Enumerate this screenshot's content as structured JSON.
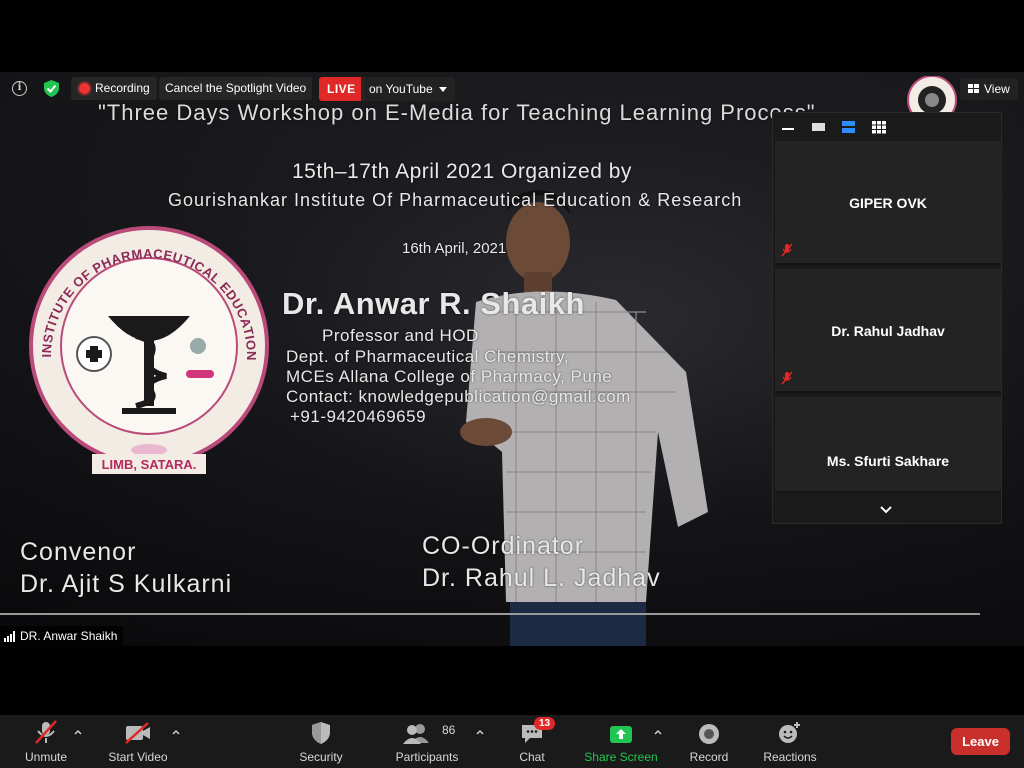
{
  "topbar": {
    "recording_label": "Recording",
    "cancel_spotlight_label": "Cancel the Spotlight Video",
    "live_label": "LIVE",
    "live_destination": "on YouTube",
    "view_label": "View"
  },
  "slide": {
    "title": "\"Three Days Workshop on E-Media for Teaching Learning Process\"",
    "dates": "15th–17th April 2021 Organized by",
    "institute": "Gourishankar Institute Of Pharmaceutical Education & Research",
    "day": "16th April, 2021",
    "speaker_name": "Dr. Anwar R. Shaikh",
    "speaker_role": "Professor and HOD",
    "speaker_dept": "Dept. of Pharmaceutical Chemistry,",
    "speaker_college": "MCEs Allana College of Pharmacy, Pune",
    "speaker_contact": "Contact: knowledgepublication@gmail.com",
    "speaker_phone": "+91-9420469659",
    "convenor_title": "Convenor",
    "convenor_name": "Dr. Ajit S Kulkarni",
    "coordinator_title": "CO-Ordinator",
    "coordinator_name": "Dr. Rahul L. Jadhav",
    "seal_text_top": "GOURISHANKAR INSTITUTE OF PHARMACEUTICAL EDUCATION AND RESEARCH",
    "seal_text_bottom": "LIMB, SATARA."
  },
  "active_speaker": {
    "name": "DR. Anwar Shaikh"
  },
  "gallery": {
    "participants": [
      {
        "name": "GIPER OVK",
        "muted": true
      },
      {
        "name": "Dr. Rahul Jadhav",
        "muted": true
      },
      {
        "name": "Ms. Sfurti Sakhare",
        "muted": true
      }
    ]
  },
  "toolbar": {
    "unmute_label": "Unmute",
    "start_video_label": "Start Video",
    "security_label": "Security",
    "participants_label": "Participants",
    "participants_count": "86",
    "chat_label": "Chat",
    "chat_badge": "13",
    "share_screen_label": "Share Screen",
    "record_label": "Record",
    "reactions_label": "Reactions",
    "leave_label": "Leave"
  },
  "colors": {
    "live_red": "#e02828",
    "share_green": "#23c552",
    "leave_red": "#c9302c",
    "toolbar_bg": "#1a1a1a"
  },
  "icons": [
    "info-icon",
    "shield-check-icon",
    "record-dot-icon",
    "chevron-down-icon",
    "view-grid-icon",
    "microphone-muted-icon",
    "video-off-icon",
    "security-shield-icon",
    "participants-icon",
    "chat-icon",
    "share-screen-icon",
    "record-icon",
    "reactions-icon"
  ]
}
